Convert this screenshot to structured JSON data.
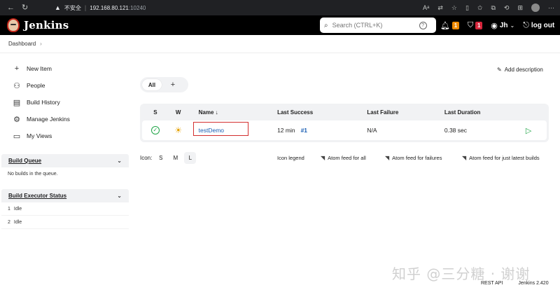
{
  "browser": {
    "security_label": "不安全",
    "host": "192.168.80.121",
    "port": ":10240",
    "icons": [
      "back-icon",
      "refresh-icon",
      "warning-icon",
      "read-aloud-icon",
      "translate-icon",
      "favorite-icon",
      "split-icon",
      "favorites-icon",
      "collections-icon",
      "history-icon",
      "extensions-icon",
      "profile-icon"
    ]
  },
  "header": {
    "title": "Jenkins",
    "search_placeholder": "Search (CTRL+K)",
    "notifications_count": "1",
    "security_count": "1",
    "user": "Jh",
    "logout": "log out",
    "colors": {
      "bar": "#000000",
      "notif": "#ef8a00",
      "security": "#d6263c"
    }
  },
  "breadcrumb": {
    "items": [
      "Dashboard"
    ]
  },
  "sidebar": {
    "items": [
      {
        "label": "New Item",
        "icon": "plus-icon"
      },
      {
        "label": "People",
        "icon": "people-icon"
      },
      {
        "label": "Build History",
        "icon": "history-icon"
      },
      {
        "label": "Manage Jenkins",
        "icon": "gear-icon"
      },
      {
        "label": "My Views",
        "icon": "window-icon"
      }
    ],
    "build_queue": {
      "title": "Build Queue",
      "empty": "No builds in the queue."
    },
    "executors": {
      "title": "Build Executor Status",
      "rows": [
        {
          "num": "1",
          "status": "Idle"
        },
        {
          "num": "2",
          "status": "Idle"
        }
      ]
    }
  },
  "main": {
    "add_description": "Add description",
    "tabs": {
      "all": "All",
      "add": "+"
    },
    "table": {
      "headers": {
        "s": "S",
        "w": "W",
        "name": "Name ↓",
        "last_success": "Last Success",
        "last_failure": "Last Failure",
        "last_duration": "Last Duration"
      },
      "rows": [
        {
          "name": "testDemo",
          "last_success": "12 min",
          "build": "#1",
          "last_failure": "N/A",
          "last_duration": "0.38 sec",
          "status": "success",
          "weather": "sunny"
        }
      ]
    },
    "icon_size": {
      "label": "Icon:",
      "sizes": [
        "S",
        "M",
        "L"
      ],
      "selected": "L"
    },
    "feeds": {
      "legend": "Icon legend",
      "all": "Atom feed for all",
      "failures": "Atom feed for failures",
      "latest": "Atom feed for just latest builds"
    }
  },
  "footer": {
    "rest_api": "REST API",
    "version": "Jenkins 2.420"
  },
  "watermark": "知乎 @三分糖 · 谢谢"
}
